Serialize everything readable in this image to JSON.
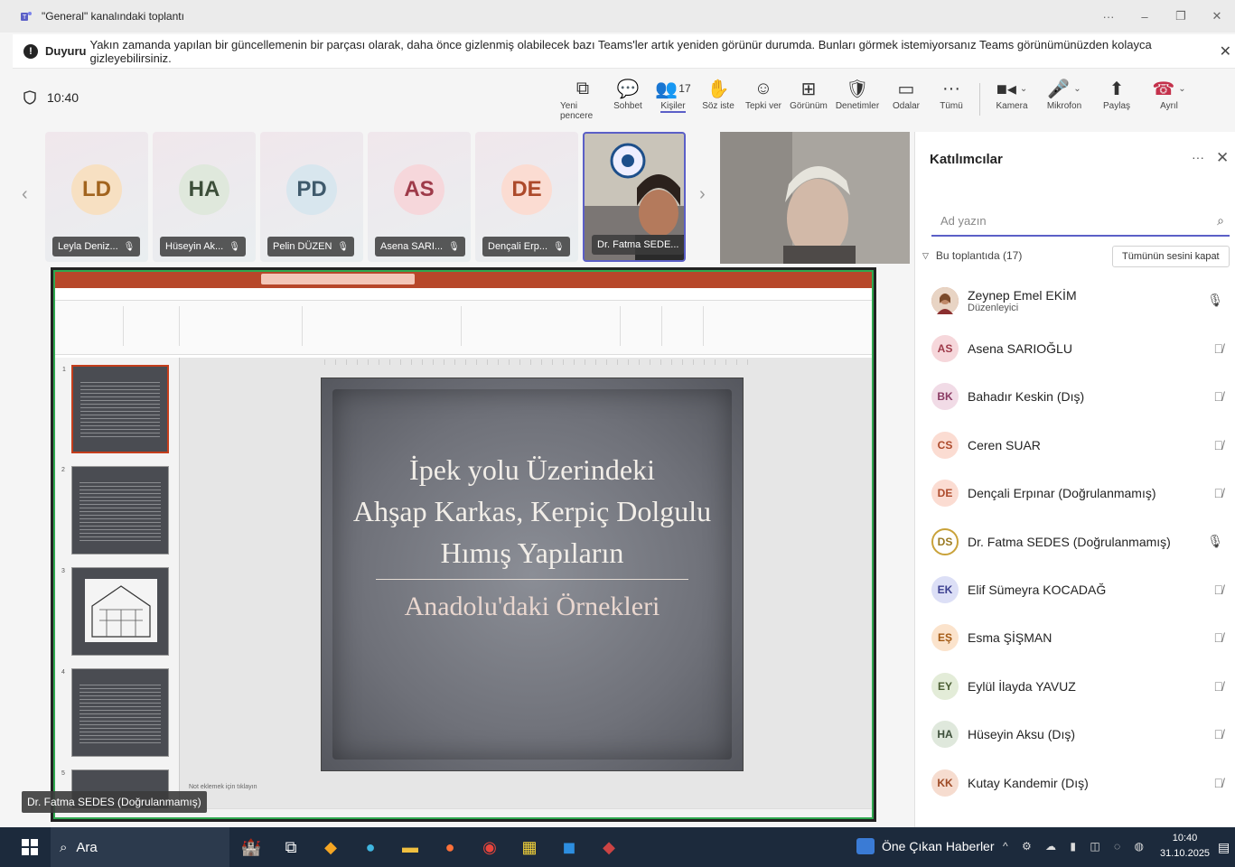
{
  "window": {
    "title": "\"General\" kanalındaki toplantı",
    "controls": [
      "···",
      "–",
      "❐",
      "✕"
    ]
  },
  "banner": {
    "bold": "Duyuru",
    "text": "Yakın zamanda yapılan bir güncellemenin bir parçası olarak, daha önce gizlenmiş olabilecek bazı Teams'ler artık yeniden görünür durumda. Bunları görmek istemiyorsanız Teams görünümünüzden kolayca gizleyebilirsiniz."
  },
  "toolbar": {
    "timer": "10:40",
    "tools": [
      {
        "label": "Yeni pencere",
        "icon": "new-window-icon",
        "glyph": "⧉"
      },
      {
        "label": "Sohbet",
        "icon": "chat-icon",
        "glyph": "💬"
      },
      {
        "label": "Kişiler",
        "icon": "people-icon",
        "glyph": "👥",
        "count": "17"
      },
      {
        "label": "Söz iste",
        "icon": "raise-hand-icon",
        "glyph": "✋"
      },
      {
        "label": "Tepki ver",
        "icon": "react-icon",
        "glyph": "☺"
      },
      {
        "label": "Görünüm",
        "icon": "view-icon",
        "glyph": "⊞"
      },
      {
        "label": "Denetimler",
        "icon": "controls-icon",
        "glyph": "🛡"
      },
      {
        "label": "Odalar",
        "icon": "rooms-icon",
        "glyph": "▭"
      },
      {
        "label": "Tümü",
        "icon": "more-icon",
        "glyph": "···"
      }
    ],
    "camera": "Kamera",
    "mic": "Mikrofon",
    "share": "Paylaş",
    "leave": "Ayrıl"
  },
  "tiles": [
    {
      "initials": "LD",
      "name": "Leyla Deniz...",
      "bg": "#f7e0c2",
      "fg": "#a2641e"
    },
    {
      "initials": "HA",
      "name": "Hüseyin Ak...",
      "bg": "#dfe8dc",
      "fg": "#3d4f3a"
    },
    {
      "initials": "PD",
      "name": "Pelin DÜZEN",
      "bg": "#d8e6ee",
      "fg": "#3f5a6c"
    },
    {
      "initials": "AS",
      "name": "Asena SARI...",
      "bg": "#f6d7db",
      "fg": "#9e3a49"
    },
    {
      "initials": "DE",
      "name": "Dençali Erp...",
      "bg": "#fbdcd2",
      "fg": "#ad4a2b"
    }
  ],
  "camTile": {
    "name": "Dr. Fatma SEDE..."
  },
  "slide": {
    "title_lines": [
      "İpek yolu Üzerindeki",
      "Ahşap Karkas, Kerpiç Dolgulu",
      "Hımış Yapıların"
    ],
    "subtitle": "Anadolu'daki Örnekleri",
    "notes": "Not eklemek için tıklayın",
    "thumb_numbers": [
      "1",
      "2",
      "3",
      "4",
      "5"
    ]
  },
  "presenter": "Dr. Fatma SEDES (Doğrulanmamış)",
  "panel": {
    "title": "Katılımcılar",
    "search_placeholder": "Ad yazın",
    "section": "Bu toplantıda (17)",
    "mute_all": "Tümünün sesini kapat",
    "participants": [
      {
        "initials": "",
        "name": "Zeynep Emel EKİM",
        "role": "Düzenleyici",
        "bg": "#c97b5b",
        "fg": "#fff",
        "mic": "on"
      },
      {
        "initials": "AS",
        "name": "Asena SARIOĞLU",
        "role": "",
        "bg": "#f6d7db",
        "fg": "#9e3a49",
        "mic": "off"
      },
      {
        "initials": "BK",
        "name": "Bahadır Keskin (Dış)",
        "role": "",
        "bg": "#f1dbe6",
        "fg": "#8a3a63",
        "mic": "off"
      },
      {
        "initials": "CS",
        "name": "Ceren SUAR",
        "role": "",
        "bg": "#fbdcd2",
        "fg": "#ad4a2b",
        "mic": "off"
      },
      {
        "initials": "DE",
        "name": "Dençali Erpınar (Doğrulanmamış)",
        "role": "",
        "bg": "#fbdcd2",
        "fg": "#ad4a2b",
        "mic": "off"
      },
      {
        "initials": "DS",
        "name": "Dr. Fatma SEDES (Doğrulanmamış)",
        "role": "",
        "bg": "#fff",
        "fg": "#9a7a22",
        "mic": "on"
      },
      {
        "initials": "EK",
        "name": "Elif Sümeyra KOCADAĞ",
        "role": "",
        "bg": "#dcdff6",
        "fg": "#3b3f8f",
        "mic": "off"
      },
      {
        "initials": "EŞ",
        "name": "Esma ŞİŞMAN",
        "role": "",
        "bg": "#fbe3cc",
        "fg": "#a45a14",
        "mic": "off"
      },
      {
        "initials": "EY",
        "name": "Eylül İlayda YAVUZ",
        "role": "",
        "bg": "#e3ecd8",
        "fg": "#4b5e33",
        "mic": "off"
      },
      {
        "initials": "HA",
        "name": "Hüseyin Aksu (Dış)",
        "role": "",
        "bg": "#dfe8dc",
        "fg": "#3d4f3a",
        "mic": "off"
      },
      {
        "initials": "KK",
        "name": "Kutay Kandemir (Dış)",
        "role": "",
        "bg": "#f6dccf",
        "fg": "#9e4a25",
        "mic": "off"
      }
    ]
  },
  "taskbar": {
    "search": "Ara",
    "news": "Öne Çıkan Haberler",
    "time": "10:40",
    "date": "31.10.2025"
  }
}
